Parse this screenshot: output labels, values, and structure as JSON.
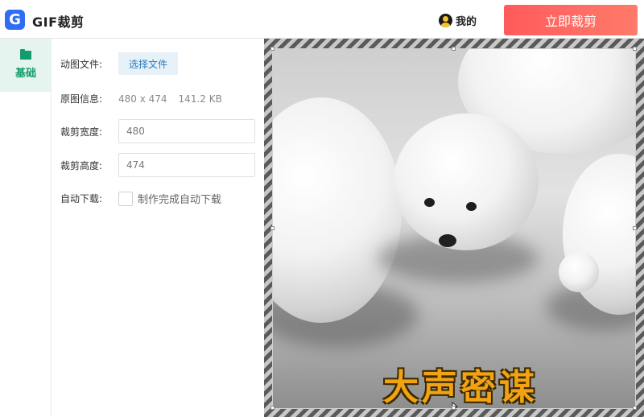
{
  "header": {
    "logo_letter": "G",
    "app_title": "GIF裁剪",
    "user_label": "我的",
    "crop_button_label": "立即裁剪"
  },
  "sidebar": {
    "tabs": [
      {
        "label": "基础",
        "icon": "folder-icon",
        "active": true
      }
    ]
  },
  "form": {
    "source_label": "动图文件:",
    "select_file_label": "选择文件",
    "info_label": "原图信息:",
    "info_dimensions": "480 x 474",
    "info_size": "141.2 KB",
    "width_label": "裁剪宽度:",
    "width_value": "480",
    "height_label": "裁剪高度:",
    "height_value": "474",
    "autodownload_label": "自动下载:",
    "autodownload_checkbox_text": "制作完成自动下载",
    "autodownload_checked": false
  },
  "preview": {
    "caption": "大声密谋"
  },
  "colors": {
    "accent": "#139c6b",
    "button_gradient_start": "#ff5b5b",
    "button_gradient_end": "#ff7a6a",
    "logo_blue": "#2f6df6",
    "link_blue": "#2a7ac0"
  }
}
